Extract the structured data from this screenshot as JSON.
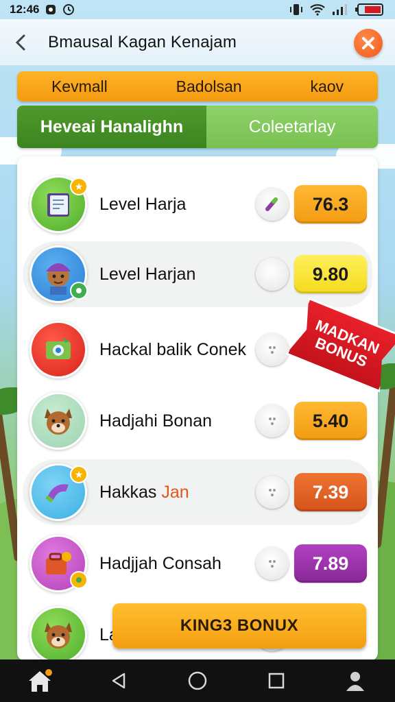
{
  "status_bar": {
    "time": "12:46",
    "icons": [
      "shield-icon",
      "clock-icon",
      "vibrate-icon",
      "wifi-icon",
      "signal-icon",
      "battery-icon"
    ]
  },
  "header": {
    "title": "Bmausal Kagan Kenajam",
    "back_icon": "chevron-left-icon",
    "close_icon": "close-icon"
  },
  "filter_tabs": [
    "Kevmall",
    "Badolsan",
    "kaov"
  ],
  "segment_tabs": {
    "active": "Heveai Hanalighn",
    "inactive": "Coleetarlay"
  },
  "rows": [
    {
      "name": "Level Harja",
      "score": "76.3",
      "score_color": "#f7a81b",
      "toggle_icon": "pen-icon",
      "avatar_icon": "notebook-icon"
    },
    {
      "name": "Level Harjan",
      "score": "9.80",
      "score_color": "#fde43a",
      "toggle_icon": "empty",
      "avatar_icon": "character-avatar"
    },
    {
      "name": "Hackal balik Conek",
      "score": "",
      "score_color": "",
      "toggle_icon": "dots-icon",
      "avatar_icon": "camera-icon"
    },
    {
      "name": "Hadjahi Bonan",
      "score": "5.40",
      "score_color": "#f7a81b",
      "toggle_icon": "dots-icon",
      "avatar_icon": "dog-avatar"
    },
    {
      "name_prefix": "Hakkas ",
      "name_accent": "Jan",
      "score": "7.39",
      "score_color": "#e0601c",
      "toggle_icon": "dots-icon",
      "avatar_icon": "magnet-icon"
    },
    {
      "name": "Hadjjah Consah",
      "score": "7.89",
      "score_color": "#9b2fa8",
      "toggle_icon": "dots-icon",
      "avatar_icon": "bag-icon"
    },
    {
      "name": "La",
      "score": "",
      "score_color": "",
      "toggle_icon": "dots-icon",
      "avatar_icon": "dog-avatar"
    }
  ],
  "bonus_ribbon": {
    "line1": "MADKAN",
    "line2": "BONUS"
  },
  "bottom_button": {
    "label": "KING3 BONUX"
  },
  "nav": [
    "home-icon",
    "back-triangle-icon",
    "home-circle-icon",
    "recents-square-icon",
    "profile-icon"
  ]
}
